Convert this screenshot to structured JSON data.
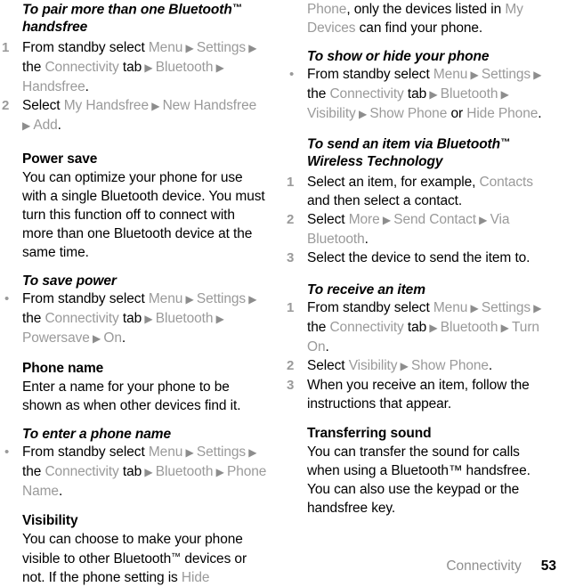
{
  "document": {
    "type": "user-manual-page",
    "footer": {
      "chapter": "Connectivity",
      "page_number": "53"
    },
    "colors": {
      "text": "#000000",
      "menu_item": "#9a9a9a",
      "marker": "#9a9a9a",
      "footer_chapter": "#8f8f8f"
    }
  },
  "left_column": {
    "heading_1": "To pair more than one Bluetooth™ handsfree",
    "steps_1": [
      {
        "marker": "1",
        "parts": [
          {
            "t": "From standby select ",
            "s": "blk"
          },
          {
            "t": "Menu",
            "s": "mi"
          },
          {
            "t": " ▶ ",
            "s": "arrow"
          },
          {
            "t": "Settings",
            "s": "mi"
          },
          {
            "t": " ▶ ",
            "s": "arrow"
          },
          {
            "t": "the ",
            "s": "blk"
          },
          {
            "t": "Connectivity",
            "s": "mi"
          },
          {
            "t": " tab",
            "s": "blk"
          },
          {
            "t": " ▶ ",
            "s": "arrow"
          },
          {
            "t": "Bluetooth",
            "s": "mi"
          },
          {
            "t": " ▶ ",
            "s": "arrow"
          },
          {
            "t": "Handsfree",
            "s": "mi"
          },
          {
            "t": ".",
            "s": "blk"
          }
        ]
      },
      {
        "marker": "2",
        "parts": [
          {
            "t": "Select ",
            "s": "blk"
          },
          {
            "t": "My Handsfree",
            "s": "mi"
          },
          {
            "t": " ▶ ",
            "s": "arrow"
          },
          {
            "t": "New Handsfree",
            "s": "mi"
          },
          {
            "t": " ▶ ",
            "s": "arrow"
          },
          {
            "t": "Add",
            "s": "mi"
          },
          {
            "t": ".",
            "s": "blk"
          }
        ]
      }
    ],
    "heading_2": "Power save",
    "paragraph_1": "You can optimize your phone for use with a single Bluetooth device. You must turn this function off to connect with more than one Bluetooth device at the same time.",
    "heading_3": "To save power",
    "steps_2": [
      {
        "marker": "•",
        "parts": [
          {
            "t": "From standby select ",
            "s": "blk"
          },
          {
            "t": "Menu",
            "s": "mi"
          },
          {
            "t": " ▶ ",
            "s": "arrow"
          },
          {
            "t": "Settings",
            "s": "mi"
          },
          {
            "t": " ▶ ",
            "s": "arrow"
          },
          {
            "t": "the ",
            "s": "blk"
          },
          {
            "t": "Connectivity",
            "s": "mi"
          },
          {
            "t": " tab",
            "s": "blk"
          },
          {
            "t": " ▶ ",
            "s": "arrow"
          },
          {
            "t": "Bluetooth",
            "s": "mi"
          },
          {
            "t": " ▶ ",
            "s": "arrow"
          },
          {
            "t": "Powersave",
            "s": "mi"
          },
          {
            "t": " ▶ ",
            "s": "arrow"
          },
          {
            "t": "On",
            "s": "mi"
          },
          {
            "t": ".",
            "s": "blk"
          }
        ]
      }
    ],
    "heading_4": "Phone name",
    "paragraph_2": "Enter a name for your phone to be shown as when other devices find it.",
    "heading_5": "To enter a phone name",
    "steps_3": [
      {
        "marker": "•",
        "parts": [
          {
            "t": "From standby select ",
            "s": "blk"
          },
          {
            "t": "Menu",
            "s": "mi"
          },
          {
            "t": " ▶ ",
            "s": "arrow"
          },
          {
            "t": "Settings",
            "s": "mi"
          },
          {
            "t": " ▶ ",
            "s": "arrow"
          },
          {
            "t": "the ",
            "s": "blk"
          },
          {
            "t": "Connectivity",
            "s": "mi"
          },
          {
            "t": " tab",
            "s": "blk"
          },
          {
            "t": " ▶ ",
            "s": "arrow"
          },
          {
            "t": "Bluetooth",
            "s": "mi"
          },
          {
            "t": " ▶ ",
            "s": "arrow"
          },
          {
            "t": "Phone Name",
            "s": "mi"
          },
          {
            "t": ".",
            "s": "blk"
          }
        ]
      }
    ],
    "heading_6": "Visibility",
    "paragraph_3_parts": [
      {
        "t": "You can choose to make your phone visible to other Bluetooth™ devices or not. If the phone setting is ",
        "s": "blk"
      },
      {
        "t": "Hide",
        "s": "mi"
      }
    ]
  },
  "right_column": {
    "paragraph_continued_parts": [
      {
        "t": "Phone",
        "s": "mi"
      },
      {
        "t": ", only the devices listed in ",
        "s": "blk"
      },
      {
        "t": "My Devices",
        "s": "mi"
      },
      {
        "t": " can find your phone.",
        "s": "blk"
      }
    ],
    "heading_1": "To show or hide your phone",
    "steps_1": [
      {
        "marker": "•",
        "parts": [
          {
            "t": "From standby select ",
            "s": "blk"
          },
          {
            "t": "Menu",
            "s": "mi"
          },
          {
            "t": " ▶ ",
            "s": "arrow"
          },
          {
            "t": "Settings",
            "s": "mi"
          },
          {
            "t": " ▶ ",
            "s": "arrow"
          },
          {
            "t": "the ",
            "s": "blk"
          },
          {
            "t": "Connectivity",
            "s": "mi"
          },
          {
            "t": " tab",
            "s": "blk"
          },
          {
            "t": " ▶ ",
            "s": "arrow"
          },
          {
            "t": "Bluetooth",
            "s": "mi"
          },
          {
            "t": " ▶ ",
            "s": "arrow"
          },
          {
            "t": "Visibility",
            "s": "mi"
          },
          {
            "t": " ▶ ",
            "s": "arrow"
          },
          {
            "t": "Show Phone",
            "s": "mi"
          },
          {
            "t": " or ",
            "s": "blk"
          },
          {
            "t": "Hide Phone",
            "s": "mi"
          },
          {
            "t": ".",
            "s": "blk"
          }
        ]
      }
    ],
    "heading_2": "To send an item via Bluetooth™ Wireless Technology",
    "steps_2": [
      {
        "marker": "1",
        "parts": [
          {
            "t": "Select an item, for example, ",
            "s": "blk"
          },
          {
            "t": "Contacts",
            "s": "mi"
          },
          {
            "t": " and then select a contact.",
            "s": "blk"
          }
        ]
      },
      {
        "marker": "2",
        "parts": [
          {
            "t": "Select ",
            "s": "blk"
          },
          {
            "t": "More",
            "s": "mi"
          },
          {
            "t": " ▶ ",
            "s": "arrow"
          },
          {
            "t": "Send Contact",
            "s": "mi"
          },
          {
            "t": " ▶ ",
            "s": "arrow"
          },
          {
            "t": "Via Bluetooth",
            "s": "mi"
          },
          {
            "t": ".",
            "s": "blk"
          }
        ]
      },
      {
        "marker": "3",
        "parts": [
          {
            "t": "Select the device to send the item to.",
            "s": "blk"
          }
        ]
      }
    ],
    "heading_3": "To receive an item",
    "steps_3": [
      {
        "marker": "1",
        "parts": [
          {
            "t": "From standby select ",
            "s": "blk"
          },
          {
            "t": "Menu",
            "s": "mi"
          },
          {
            "t": " ▶ ",
            "s": "arrow"
          },
          {
            "t": "Settings",
            "s": "mi"
          },
          {
            "t": " ▶ ",
            "s": "arrow"
          },
          {
            "t": "the ",
            "s": "blk"
          },
          {
            "t": "Connectivity",
            "s": "mi"
          },
          {
            "t": " tab",
            "s": "blk"
          },
          {
            "t": " ▶ ",
            "s": "arrow"
          },
          {
            "t": "Bluetooth",
            "s": "mi"
          },
          {
            "t": " ▶ ",
            "s": "arrow"
          },
          {
            "t": "Turn On",
            "s": "mi"
          },
          {
            "t": ".",
            "s": "blk"
          }
        ]
      },
      {
        "marker": "2",
        "parts": [
          {
            "t": "Select ",
            "s": "blk"
          },
          {
            "t": "Visibility",
            "s": "mi"
          },
          {
            "t": " ▶ ",
            "s": "arrow"
          },
          {
            "t": "Show Phone",
            "s": "mi"
          },
          {
            "t": ".",
            "s": "blk"
          }
        ]
      },
      {
        "marker": "3",
        "parts": [
          {
            "t": "When you receive an item, follow the instructions that appear.",
            "s": "blk"
          }
        ]
      }
    ],
    "heading_4": "Transferring sound",
    "paragraph_1": "You can transfer the sound for calls when using a Bluetooth™ handsfree. You can also use the keypad or the handsfree key."
  }
}
